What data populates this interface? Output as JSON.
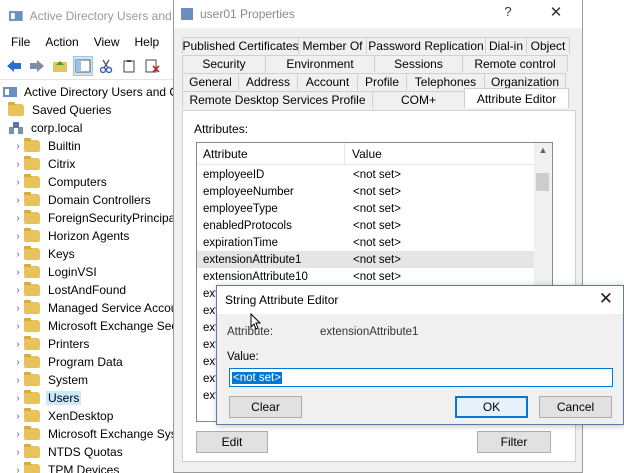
{
  "aduc": {
    "title": "Active Directory Users and C",
    "menu": [
      "File",
      "Action",
      "View",
      "Help"
    ],
    "tree": [
      {
        "label": "Active Directory Users and Con",
        "indent": 0,
        "type": "root"
      },
      {
        "label": "Saved Queries",
        "indent": 1,
        "type": "folder"
      },
      {
        "label": "corp.local",
        "indent": 1,
        "type": "domain"
      },
      {
        "label": "Builtin",
        "indent": 2,
        "type": "folder"
      },
      {
        "label": "Citrix",
        "indent": 2,
        "type": "folder"
      },
      {
        "label": "Computers",
        "indent": 2,
        "type": "folder"
      },
      {
        "label": "Domain Controllers",
        "indent": 2,
        "type": "folder"
      },
      {
        "label": "ForeignSecurityPrincipal",
        "indent": 2,
        "type": "folder"
      },
      {
        "label": "Horizon Agents",
        "indent": 2,
        "type": "folder"
      },
      {
        "label": "Keys",
        "indent": 2,
        "type": "folder"
      },
      {
        "label": "LoginVSI",
        "indent": 2,
        "type": "folder"
      },
      {
        "label": "LostAndFound",
        "indent": 2,
        "type": "folder"
      },
      {
        "label": "Managed Service Accou",
        "indent": 2,
        "type": "folder"
      },
      {
        "label": "Microsoft Exchange Sec",
        "indent": 2,
        "type": "folder"
      },
      {
        "label": "Printers",
        "indent": 2,
        "type": "folder"
      },
      {
        "label": "Program Data",
        "indent": 2,
        "type": "folder"
      },
      {
        "label": "System",
        "indent": 2,
        "type": "folder"
      },
      {
        "label": "Users",
        "indent": 2,
        "type": "folder",
        "selected": true
      },
      {
        "label": "XenDesktop",
        "indent": 2,
        "type": "folder"
      },
      {
        "label": "Microsoft Exchange Sys",
        "indent": 2,
        "type": "folder"
      },
      {
        "label": "NTDS Quotas",
        "indent": 2,
        "type": "folder"
      },
      {
        "label": "TPM Devices",
        "indent": 2,
        "type": "folder"
      }
    ]
  },
  "properties": {
    "title": "user01 Properties",
    "help_glyph": "?",
    "close_glyph": "✕",
    "tabs_row1": [
      "Published Certificates",
      "Member Of",
      "Password Replication",
      "Dial-in",
      "Object"
    ],
    "tabs_row2": [
      "Security",
      "Environment",
      "Sessions",
      "Remote control"
    ],
    "tabs_row3": [
      "General",
      "Address",
      "Account",
      "Profile",
      "Telephones",
      "Organization"
    ],
    "tabs_row4": [
      "Remote Desktop Services Profile",
      "COM+",
      "Attribute Editor"
    ],
    "attributes_label": "Attributes:",
    "col_attribute": "Attribute",
    "col_value": "Value",
    "rows": [
      {
        "name": "employeeID",
        "value": "<not set>"
      },
      {
        "name": "employeeNumber",
        "value": "<not set>"
      },
      {
        "name": "employeeType",
        "value": "<not set>"
      },
      {
        "name": "enabledProtocols",
        "value": "<not set>"
      },
      {
        "name": "expirationTime",
        "value": "<not set>"
      },
      {
        "name": "extensionAttribute1",
        "value": "<not set>"
      },
      {
        "name": "extensionAttribute10",
        "value": "<not set>"
      },
      {
        "name": "ext",
        "value": ""
      },
      {
        "name": "ext",
        "value": ""
      },
      {
        "name": "ext",
        "value": ""
      },
      {
        "name": "ext",
        "value": ""
      },
      {
        "name": "ext",
        "value": ""
      },
      {
        "name": "ext",
        "value": ""
      },
      {
        "name": "ext",
        "value": ""
      }
    ],
    "edit_button": "Edit",
    "filter_button": "Filter"
  },
  "editor": {
    "title": "String Attribute Editor",
    "close_glyph": "✕",
    "attribute_label": "Attribute:",
    "attribute_value": "extensionAttribute1",
    "value_label": "Value:",
    "value": "<not set>",
    "clear_button": "Clear",
    "ok_button": "OK",
    "cancel_button": "Cancel"
  },
  "colors": {
    "accent": "#0078d7",
    "selection_tree": "#cce8ff",
    "folder": "#e8c25b"
  }
}
